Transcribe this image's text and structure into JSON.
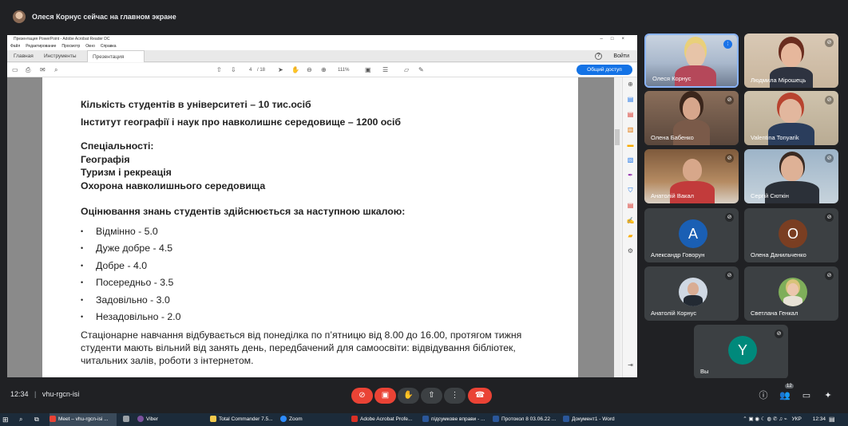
{
  "presenter_banner": "Олеся Корнус сейчас на главном экране",
  "acrobat": {
    "window_title": "Презентация PowerPoint - Adobe Acrobat Reader DC",
    "menu": [
      "Файл",
      "Редактирование",
      "Просмотр",
      "Окно",
      "Справка"
    ],
    "tabs": [
      "Главная",
      "Инструменты",
      "Презентация Powe..."
    ],
    "tab_close": "×",
    "signin": "Войти",
    "help": "?",
    "page_current": "4",
    "page_total": "/ 18",
    "zoom": "111%",
    "share_button": "Общий доступ",
    "window_buttons": "–□×"
  },
  "document": {
    "line1": "Кількість студентів в університеті – 10 тис.осіб",
    "line2": "Інститут географії і наук про навколишнє середовище – 1200 осіб",
    "spec_heading": "Спеціальності:",
    "specialties": [
      "Географія",
      "Туризм і рекреація",
      "Охорона навколишнього середовища"
    ],
    "grading_heading": "Оцінювання знань студентів здійснюється за наступною шкалою:",
    "grades": [
      "Відмінно - 5.0",
      "Дуже добре - 4.5",
      "Добре - 4.0",
      "Посередньо - 3.5",
      "Задовільно - 3.0",
      "Незадовільно - 2.0"
    ],
    "paragraph": "Стаціонарне навчання відбувається від понеділка по п’ятницю від 8.00 до 16.00, протягом тижня студенти мають вільний від занять день, передбачений для самоосвіти: відвідування бібліотек, читальних залів, роботи з інтернетом."
  },
  "participants": [
    {
      "name": "Олеся Корнус",
      "muted": false,
      "speaking": true
    },
    {
      "name": "Людмила Мірошець",
      "muted": true
    },
    {
      "name": "Олена Бабенко",
      "muted": true
    },
    {
      "name": "Valentina Tonyarik",
      "muted": true
    },
    {
      "name": "Анатолій Вакал",
      "muted": true
    },
    {
      "name": "Сергій Сюткін",
      "muted": true
    },
    {
      "name": "Александр Говорун",
      "muted": true,
      "initial": "A",
      "color": "#1a5fb4"
    },
    {
      "name": "Олена Данильченко",
      "muted": true,
      "initial": "О",
      "color": "#7a3e22"
    },
    {
      "name": "Анатолій Корнус",
      "muted": true
    },
    {
      "name": "Светлана Генкал",
      "muted": true
    },
    {
      "name": "Вы",
      "muted": true,
      "initial": "Y",
      "color": "#00897b"
    }
  ],
  "meeting": {
    "time": "12:34",
    "separator": "|",
    "code": "vhu-rgcn-isi",
    "people_count": "12"
  },
  "taskbar": {
    "items": [
      "Meet – vhu-rgcn-isi ...",
      "Viber",
      "Total Commander 7.5...",
      "Zoom",
      "Adobe Acrobat Profe...",
      "підсумкове вправи - ...",
      "Протокол 8 03.06.22 ...",
      "Документ1 - Word"
    ],
    "lang": "УКР",
    "clock": "12:34"
  },
  "colors": {
    "hangup": "#ea4335",
    "muted_btn": "#ea4335",
    "active_speaker_border": "#8ab4f8",
    "share_blue": "#1473e6"
  }
}
